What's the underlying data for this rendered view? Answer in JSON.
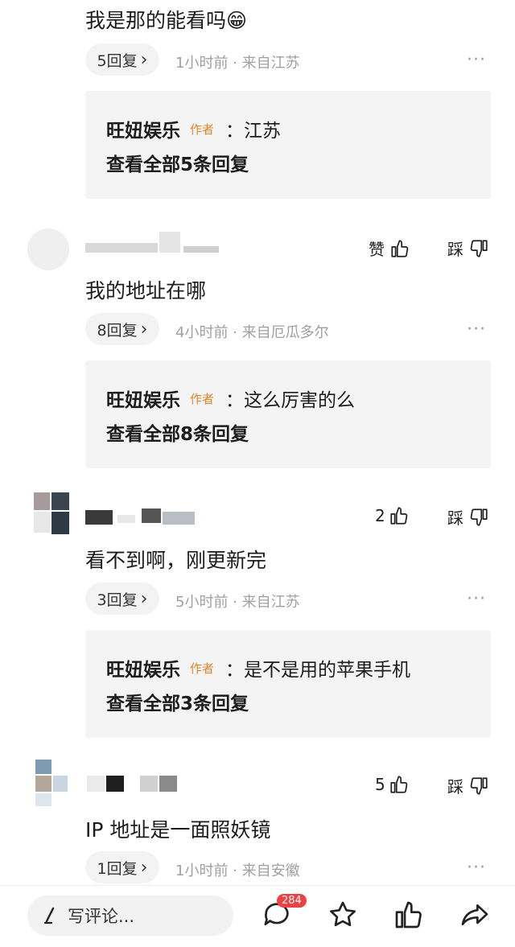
{
  "comments": [
    {
      "text": "我是那的能看吗😁",
      "reply_count_label": "5回复",
      "meta": "1小时前 · 来自江苏",
      "author_reply": {
        "name": "旺妞娱乐",
        "tag": "作者",
        "text": "：江苏",
        "view_all": "查看全部5条回复"
      }
    },
    {
      "like_label": "赞",
      "dislike_label": "踩",
      "text": "我的地址在哪",
      "reply_count_label": "8回复",
      "meta": "4小时前 · 来自厄瓜多尔",
      "author_reply": {
        "name": "旺妞娱乐",
        "tag": "作者",
        "text": "：这么厉害的么",
        "view_all": "查看全部8条回复"
      }
    },
    {
      "like_count": "2",
      "dislike_label": "踩",
      "text": "看不到啊，刚更新完",
      "reply_count_label": "3回复",
      "meta": "5小时前 · 来自江苏",
      "author_reply": {
        "name": "旺妞娱乐",
        "tag": "作者",
        "text": "：是不是用的苹果手机",
        "view_all": "查看全部3条回复"
      }
    },
    {
      "like_count": "5",
      "dislike_label": "踩",
      "text": "IP 地址是一面照妖镜",
      "reply_count_label": "1回复",
      "meta": "1小时前 · 来自安徽"
    }
  ],
  "more_label": "···",
  "chevron": "›",
  "bottom_bar": {
    "input_placeholder": "写评论...",
    "comment_badge": "284"
  },
  "colors": {
    "author_tag": "#e0872d",
    "badge": "#f04142"
  }
}
